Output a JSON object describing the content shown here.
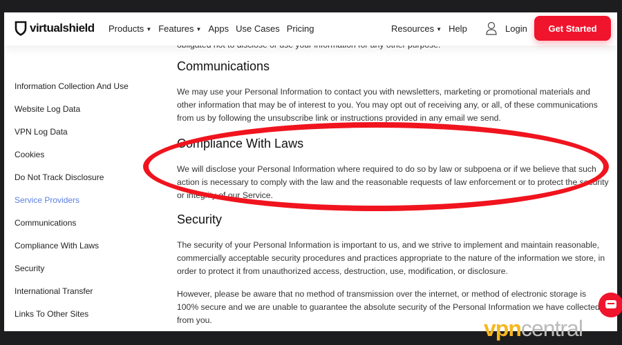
{
  "header": {
    "brand": "virtualshield",
    "nav": [
      "Products",
      "Features",
      "Apps",
      "Use Cases",
      "Pricing"
    ],
    "nav_dropdowns": [
      "Products",
      "Features"
    ],
    "resources": "Resources",
    "help": "Help",
    "login": "Login",
    "cta": "Get Started"
  },
  "sidebar": {
    "items": [
      "Information Collection And Use",
      "Website Log Data",
      "VPN Log Data",
      "Cookies",
      "Do Not Track Disclosure",
      "Service Providers",
      "Communications",
      "Compliance With Laws",
      "Security",
      "International Transfer",
      "Links To Other Sites"
    ],
    "active": "Service Providers",
    "active_color": "#5b7fe0"
  },
  "content": {
    "partial_top": "obligated not to disclose or use your information for any other purpose.",
    "sections": [
      {
        "title": "Communications",
        "paragraphs": [
          "We may use your Personal Information to contact you with newsletters, marketing or promotional materials and other information that may be of interest to you. You may opt out of receiving any, or all, of these communications from us by following the unsubscribe link or instructions provided in any email we send."
        ]
      },
      {
        "title": "Compliance With Laws",
        "paragraphs": [
          "We will disclose your Personal Information where required to do so by law or subpoena or if we believe that such action is necessary to comply with the law and the reasonable requests of law enforcement or to protect the security or integrity of our Service."
        ]
      },
      {
        "title": "Security",
        "paragraphs": [
          "The security of your Personal Information is important to us, and we strive to implement and maintain reasonable, commercially acceptable security procedures and practices appropriate to the nature of the information we store, in order to protect it from unauthorized access, destruction, use, modification, or disclosure.",
          "However, please be aware that no method of transmission over the internet, or method of electronic storage is 100% secure and we are unable to guarantee the absolute security of the Personal Information we have collected from you."
        ]
      }
    ]
  },
  "highlight_color": "#f0141e",
  "watermark": {
    "part1": "vpn",
    "part2": "central"
  }
}
